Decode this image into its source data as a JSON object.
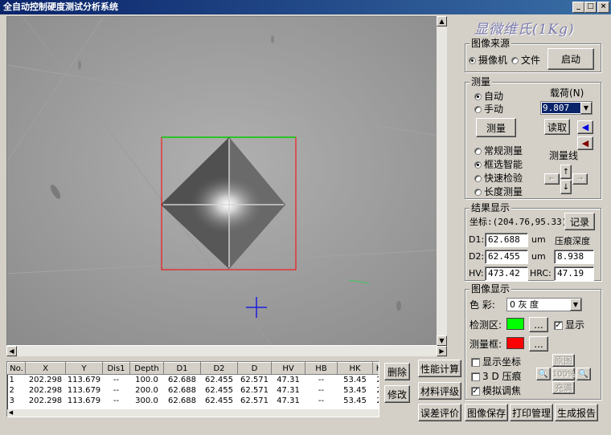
{
  "window": {
    "title": "全自动控制硬度测试分析系统",
    "min": "_",
    "max": "□",
    "close": "×"
  },
  "panel_title": "显微维氏(1Kg)",
  "source": {
    "group": "图像来源",
    "camera": "摄像机",
    "file": "文件",
    "start": "启动"
  },
  "measure": {
    "group": "测量",
    "auto": "自动",
    "manual": "手动",
    "load_label": "载荷(N)",
    "load_value": "9.807",
    "measure_btn": "测量",
    "read_btn": "读取",
    "modes": [
      "常规测量",
      "框选智能",
      "快速检验",
      "长度测量"
    ],
    "line_label": "测量线"
  },
  "result": {
    "group": "结果显示",
    "coord": "坐标:(204.76,95.33)",
    "record": "记录",
    "d1_label": "D1:",
    "d1": "62.688",
    "d2_label": "D2:",
    "d2": "62.455",
    "unit": "um",
    "depth_label": "压痕深度",
    "depth": "8.938",
    "hv_label": "HV:",
    "hv": "473.42",
    "hrc_label": "HRC:",
    "hrc": "47.19"
  },
  "display": {
    "group": "图像显示",
    "color_label": "色  彩:",
    "color_value": "0  灰   度",
    "detect_label": "检测区:",
    "dots": "...",
    "show": "显示",
    "frame_label": "测量框:",
    "show_coord": "显示坐标",
    "d3": "3 D 压痕",
    "blur": "模拟调焦",
    "original": "原图",
    "zoom": "100%",
    "fill": "充满",
    "detect_color": "#00ff00",
    "frame_color": "#ff0000"
  },
  "table": {
    "headers": [
      "No.",
      "X",
      "Y",
      "Dis1",
      "Depth",
      "D1",
      "D2",
      "D",
      "HV",
      "HB",
      "HK",
      "H"
    ],
    "rows": [
      [
        "1",
        "202.298",
        "113.679",
        "--",
        "100.0",
        "62.688",
        "62.455",
        "62.571",
        "47.31",
        "--",
        "53.45",
        "2"
      ],
      [
        "2",
        "202.298",
        "113.679",
        "--",
        "200.0",
        "62.688",
        "62.455",
        "62.571",
        "47.31",
        "--",
        "53.45",
        "2"
      ],
      [
        "3",
        "202.298",
        "113.679",
        "--",
        "300.0",
        "62.688",
        "62.455",
        "62.571",
        "47.31",
        "--",
        "53.45",
        "2"
      ]
    ]
  },
  "buttons": {
    "delete": "删除",
    "modify": "修改",
    "perf": "性能计算",
    "material": "材料评级",
    "error": "误差评价",
    "save": "图像保存",
    "print": "打印管理",
    "report": "生成报告"
  }
}
